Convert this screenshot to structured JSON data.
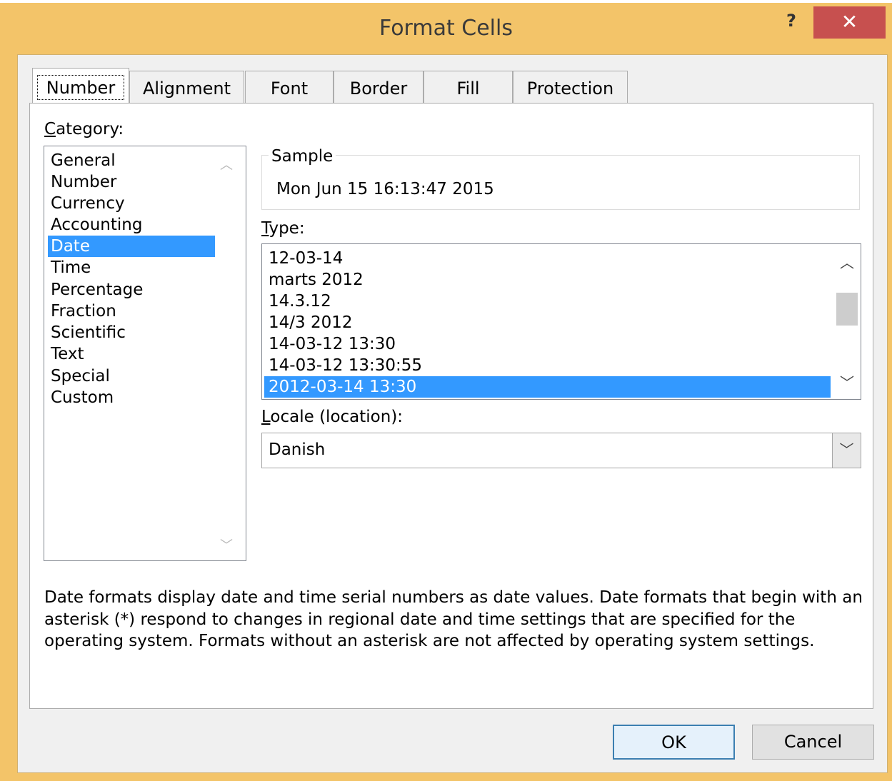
{
  "window": {
    "title": "Format Cells",
    "help": "?",
    "close": "✕"
  },
  "tabs": [
    "Number",
    "Alignment",
    "Font",
    "Border",
    "Fill",
    "Protection"
  ],
  "category": {
    "label_u": "C",
    "label_rest": "ategory:",
    "items": [
      "General",
      "Number",
      "Currency",
      "Accounting",
      "Date",
      "Time",
      "Percentage",
      "Fraction",
      "Scientific",
      "Text",
      "Special",
      "Custom"
    ],
    "selected": "Date"
  },
  "sample": {
    "legend": "Sample",
    "value": "Mon Jun 15 16:13:47 2015"
  },
  "type": {
    "label_u": "T",
    "label_rest": "ype:",
    "items": [
      "12-03-14",
      "marts 2012",
      "14.3.12",
      "14/3 2012",
      "14-03-12 13:30",
      "14-03-12 13:30:55",
      "2012-03-14 13:30"
    ],
    "selected": "2012-03-14 13:30"
  },
  "locale": {
    "label_u": "L",
    "label_rest": "ocale (location):",
    "value": "Danish"
  },
  "description": "Date formats display date and time serial numbers as date values.  Date formats that begin with an asterisk (*) respond to changes in regional date and time settings that are specified for the operating system. Formats without an asterisk are not affected by operating system settings.",
  "buttons": {
    "ok": "OK",
    "cancel": "Cancel"
  },
  "colors": {
    "title_bar": "#f3c469",
    "close": "#c7504f",
    "selection": "#3399ff"
  }
}
